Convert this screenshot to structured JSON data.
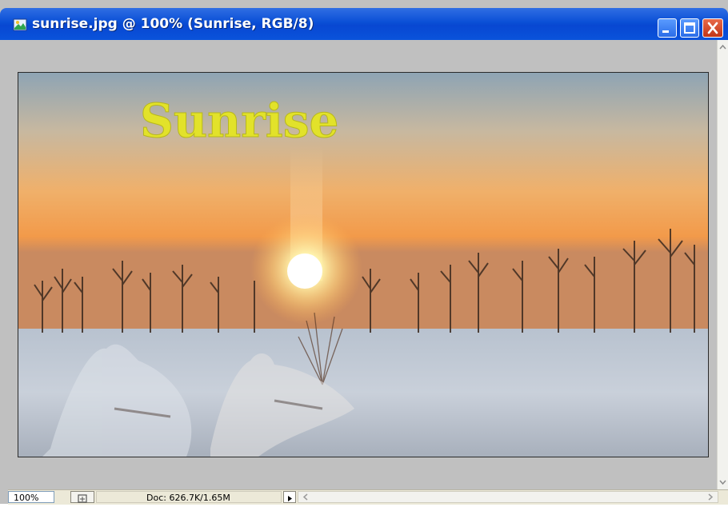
{
  "window": {
    "title": "sunrise.jpg @ 100% (Sunrise, RGB/8)",
    "title_icon": "photoshop-document-icon",
    "buttons": [
      "minimize-icon",
      "maximize-icon",
      "close-icon"
    ]
  },
  "document": {
    "overlay_text": "Sunrise",
    "overlay_color": "#e2e22a"
  },
  "statusbar": {
    "zoom": "100%",
    "doc_info": "Doc: 626.7K/1.65M"
  },
  "colors": {
    "titlebar": "#0a4fd6",
    "workspace": "#c0c0c0",
    "statusbar": "#ece9d8"
  }
}
